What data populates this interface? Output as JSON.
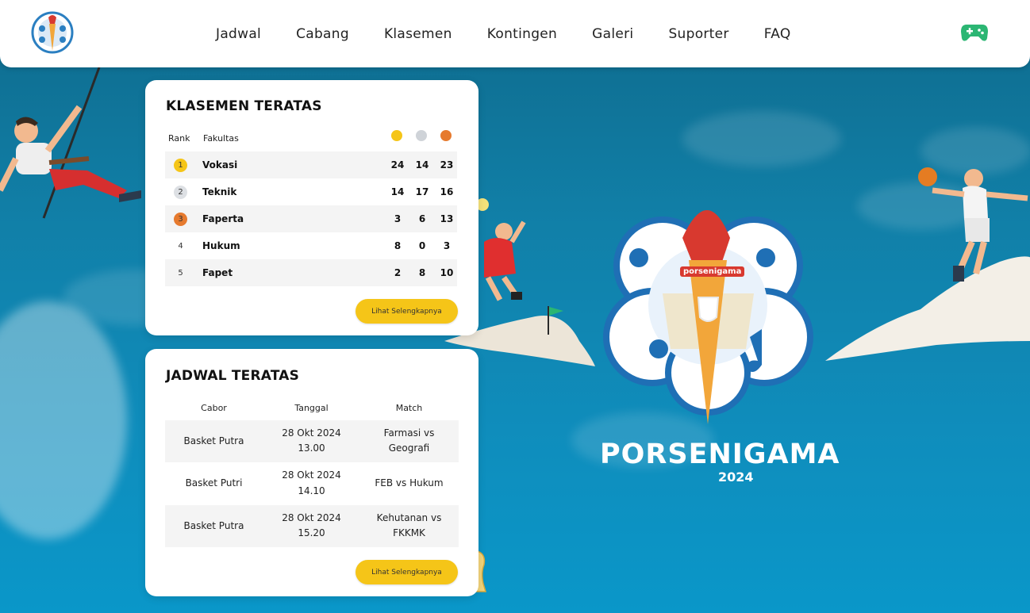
{
  "nav": {
    "links": [
      "Jadwal",
      "Cabang",
      "Klasemen",
      "Kontingen",
      "Galeri",
      "Suporter",
      "FAQ"
    ]
  },
  "standings": {
    "title": "KLASEMEN TERATAS",
    "headers": {
      "rank": "Rank",
      "faculty": "Fakultas"
    },
    "medal_colors": {
      "gold": "#f5c518",
      "silver": "#cfd3d8",
      "bronze": "#e67a2e"
    },
    "rows": [
      {
        "rank": "1",
        "name": "Vokasi",
        "gold": "24",
        "silver": "14",
        "bronze": "23"
      },
      {
        "rank": "2",
        "name": "Teknik",
        "gold": "14",
        "silver": "17",
        "bronze": "16"
      },
      {
        "rank": "3",
        "name": "Faperta",
        "gold": "3",
        "silver": "6",
        "bronze": "13"
      },
      {
        "rank": "4",
        "name": "Hukum",
        "gold": "8",
        "silver": "0",
        "bronze": "3"
      },
      {
        "rank": "5",
        "name": "Fapet",
        "gold": "2",
        "silver": "8",
        "bronze": "10"
      }
    ],
    "more_label": "Lihat Selengkapnya"
  },
  "schedule": {
    "title": "JADWAL TERATAS",
    "headers": {
      "sport": "Cabor",
      "date": "Tanggal",
      "match": "Match"
    },
    "rows": [
      {
        "sport": "Basket Putra",
        "date": "28 Okt 2024",
        "time": "13.00",
        "match_l1": "Farmasi vs",
        "match_l2": "Geografi"
      },
      {
        "sport": "Basket Putri",
        "date": "28 Okt 2024",
        "time": "14.10",
        "match_l1": "FEB vs Hukum",
        "match_l2": ""
      },
      {
        "sport": "Basket Putra",
        "date": "28 Okt 2024",
        "time": "15.20",
        "match_l1": "Kehutanan vs",
        "match_l2": "FKKMK"
      }
    ],
    "more_label": "Lihat Selengkapnya"
  },
  "hero": {
    "title": "PORSENIGAMA",
    "year": "2024",
    "badge": "porsenigama"
  },
  "icons": {
    "logo": "porsenigama-logo",
    "game": "gamepad-icon"
  },
  "colors": {
    "accent": "#f5c518",
    "bg": "#117fa7",
    "game_icon": "#2bb673"
  }
}
